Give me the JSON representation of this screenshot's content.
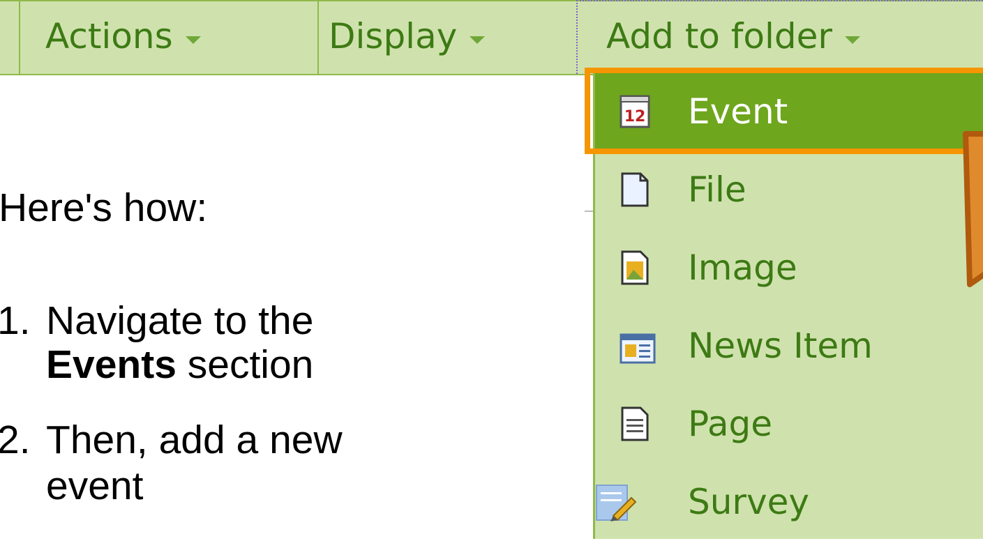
{
  "toolbar": {
    "actions_label": "Actions",
    "display_label": "Display",
    "add_to_folder_label": "Add to folder"
  },
  "menu": {
    "items": [
      {
        "label": "Event",
        "icon": "calendar-icon",
        "active": true
      },
      {
        "label": "File",
        "icon": "file-icon",
        "active": false
      },
      {
        "label": "Image",
        "icon": "image-icon",
        "active": false
      },
      {
        "label": "News Item",
        "icon": "news-icon",
        "active": false
      },
      {
        "label": "Page",
        "icon": "page-icon",
        "active": false
      },
      {
        "label": "Survey",
        "icon": "survey-icon",
        "active": false
      }
    ]
  },
  "instructions": {
    "intro": "Here's how:",
    "step1_num": "1.",
    "step1_line1": "Navigate to the",
    "step1_bold": "Events",
    "step1_rest": " section",
    "step2_num": "2.",
    "step2_line1": "Then, add a new",
    "step2_line2": "event"
  },
  "colors": {
    "toolbar_bg": "#cfe2ad",
    "accent_green": "#6ea61e",
    "text_green": "#3d7a14",
    "highlight_orange": "#f59500"
  }
}
